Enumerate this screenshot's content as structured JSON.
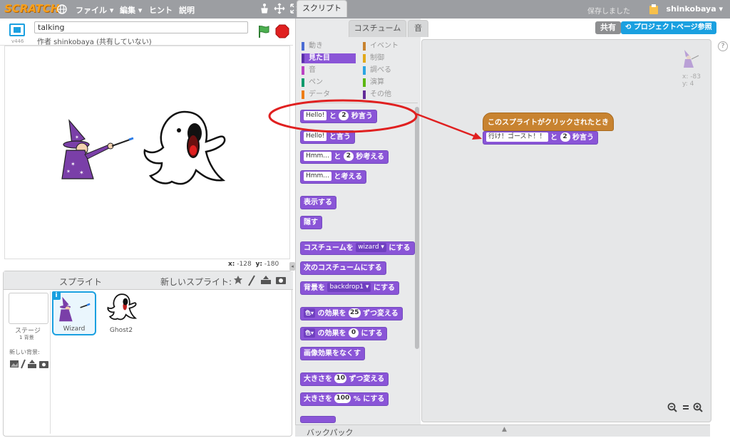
{
  "app": {
    "logo": "SCRATCH"
  },
  "menubar": {
    "file": "ファイル ▾",
    "edit": "編集 ▾",
    "tips": "ヒント",
    "about": "説明",
    "saved_status": "保存しました",
    "username": "shinkobaya ▾"
  },
  "stage_header": {
    "project_title": "talking",
    "author_line": "作者 shinkobaya (共有していない)",
    "version": "v446"
  },
  "stage": {
    "mouse_x_label": "x:",
    "mouse_x": "-128",
    "mouse_y_label": "y:",
    "mouse_y": "-180"
  },
  "sprite_pane": {
    "title": "スプライト",
    "new_sprite_label": "新しいスプライト:",
    "stage_label": "ステージ",
    "stage_backdrops": "1 背景",
    "new_backdrop_label": "新しい背景:",
    "sprites": [
      {
        "name": "Wizard"
      },
      {
        "name": "Ghost2"
      }
    ]
  },
  "tabs": {
    "scripts": "スクリプト",
    "costumes": "コスチューム",
    "sounds": "音"
  },
  "categories": [
    {
      "label": "動き",
      "color": "#4a6cd4"
    },
    {
      "label": "イベント",
      "color": "#c88330"
    },
    {
      "label": "見た目",
      "color": "#8a55d7",
      "selected": true
    },
    {
      "label": "制御",
      "color": "#e1a91a"
    },
    {
      "label": "音",
      "color": "#bb42c3"
    },
    {
      "label": "調べる",
      "color": "#2ca5e2"
    },
    {
      "label": "ペン",
      "color": "#0e9a6c"
    },
    {
      "label": "演算",
      "color": "#5cb712"
    },
    {
      "label": "データ",
      "color": "#ee7d16"
    },
    {
      "label": "その他",
      "color": "#632d99"
    }
  ],
  "palette_blocks": {
    "say_secs": {
      "field": "Hello!",
      "mid": "と",
      "num": "2",
      "tail": "秒言う"
    },
    "say": {
      "field": "Hello!",
      "tail": "と言う"
    },
    "think_secs": {
      "field": "Hmm...",
      "mid": "と",
      "num": "2",
      "tail": "秒考える"
    },
    "think": {
      "field": "Hmm...",
      "tail": "と考える"
    },
    "show": "表示する",
    "hide": "隠す",
    "switch_costume": {
      "head": "コスチュームを",
      "dd": "wizard",
      "tail": "にする"
    },
    "next_costume": "次のコスチュームにする",
    "switch_backdrop": {
      "head": "背景を",
      "dd": "backdrop1",
      "tail": "にする"
    },
    "change_effect": {
      "dd": "色",
      "mid": "の効果を",
      "num": "25",
      "tail": "ずつ変える"
    },
    "set_effect": {
      "dd": "色",
      "mid": "の効果を",
      "num": "0",
      "tail": "にする"
    },
    "clear_effects": "画像効果をなくす",
    "change_size": {
      "head": "大きさを",
      "num": "10",
      "tail": "ずつ変える"
    },
    "set_size": {
      "head": "大きさを",
      "num": "100",
      "tail": "% にする"
    }
  },
  "backpack": {
    "label": "バックパック"
  },
  "header_buttons": {
    "share": "共有",
    "project_page": "プロジェクトページ参照"
  },
  "script": {
    "hat": "このスプライトがクリックされたとき",
    "say_field": "行け！ゴースト！！",
    "say_mid": "と",
    "say_num": "2",
    "say_tail": "秒言う"
  },
  "sprite_info": {
    "x": "x: -83",
    "y": "y: 4"
  },
  "zoom_controls": "🔍 = 🔍"
}
